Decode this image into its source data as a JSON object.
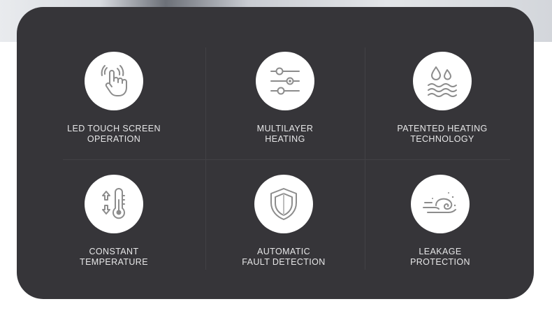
{
  "features": [
    {
      "icon": "touch-hand-icon",
      "line1": "LED TOUCH SCREEN",
      "line2": "OPERATION"
    },
    {
      "icon": "slider-layers-icon",
      "line1": "MULTILAYER",
      "line2": "HEATING"
    },
    {
      "icon": "water-heat-icon",
      "line1": "PATENTED HEATING",
      "line2": "TECHNOLOGY"
    },
    {
      "icon": "thermometer-icon",
      "line1": "CONSTANT",
      "line2": "TEMPERATURE"
    },
    {
      "icon": "shield-icon",
      "line1": "AUTOMATIC",
      "line2": "FAULT DETECTION"
    },
    {
      "icon": "leakage-wave-icon",
      "line1": "LEAKAGE",
      "line2": "PROTECTION"
    }
  ],
  "colors": {
    "panel": "#363539",
    "icon_background": "#ffffff",
    "icon_stroke": "#8c8c8c",
    "label_text": "#e7e7e8"
  }
}
